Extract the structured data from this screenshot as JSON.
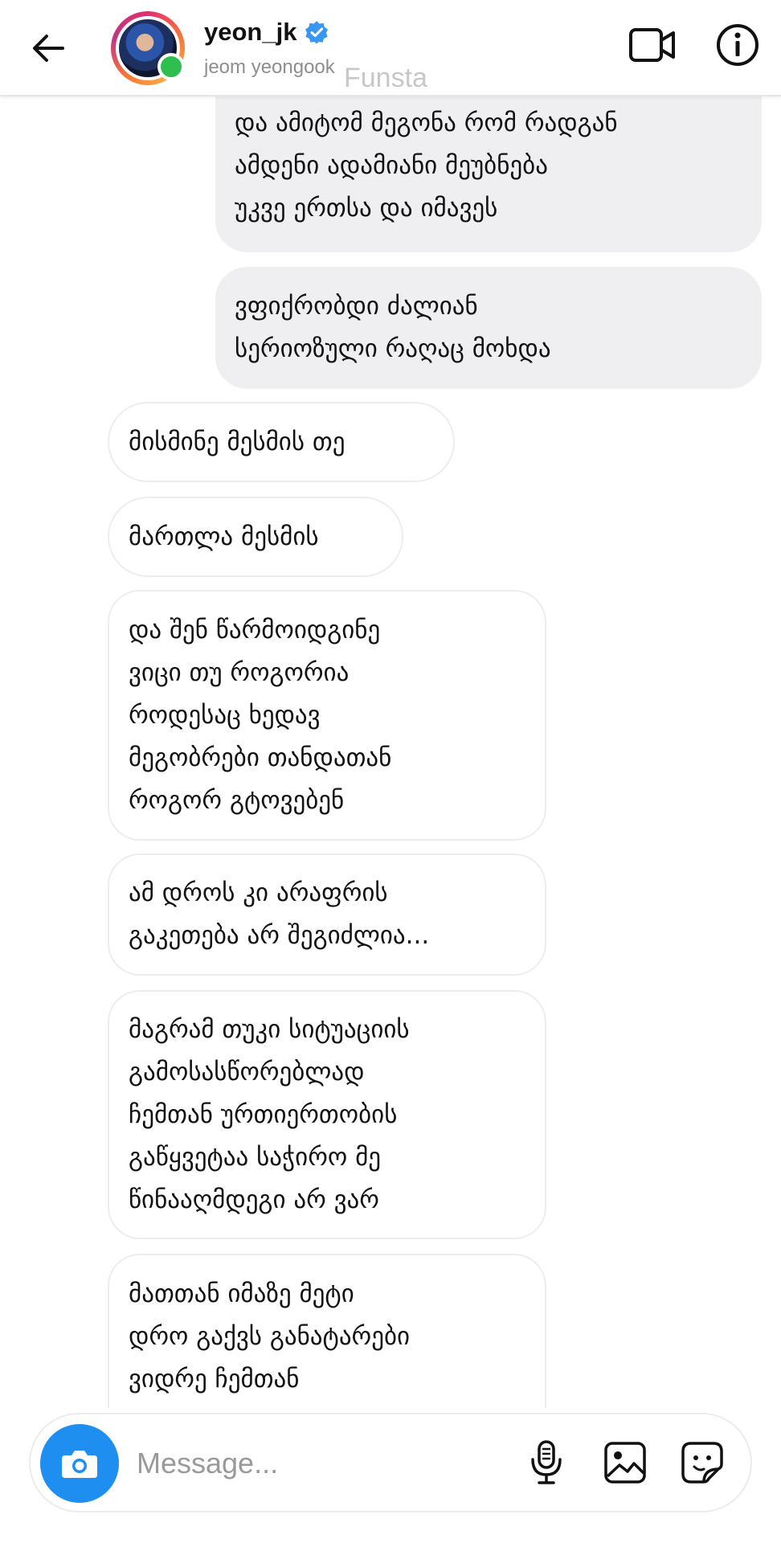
{
  "header": {
    "username": "yeon_jk",
    "subname": "jeom yeongook",
    "watermark": "Funsta"
  },
  "icons": {
    "back": "arrow-left-icon",
    "verified": "verified-badge-icon",
    "video": "video-call-icon",
    "info": "info-icon",
    "camera": "camera-icon",
    "mic": "microphone-icon",
    "gallery": "gallery-icon",
    "sticker": "sticker-icon"
  },
  "colors": {
    "accent": "#1f8ef1",
    "verified": "#3897f0",
    "online": "#2fbf4f",
    "sent_bubble": "#efeff1"
  },
  "messages": [
    {
      "direction": "sent",
      "text": "და ამიტომ მეგონა რომ რადგან\nამდენი ადამიანი მეუბნება\nუკვე ერთსა და იმავეს"
    },
    {
      "direction": "sent",
      "text": "ვფიქრობდი ძალიან\nსერიოზული რაღაც მოხდა"
    },
    {
      "direction": "received",
      "text": "მისმინე მესმის თე"
    },
    {
      "direction": "received",
      "text": "მართლა მესმის"
    },
    {
      "direction": "received",
      "text": "და შენ წარმოიდგინე\nვიცი თუ როგორია\nროდესაც ხედავ\nმეგობრები თანდათან\nროგორ გტოვებენ"
    },
    {
      "direction": "received",
      "text": "ამ დროს კი არაფრის\nგაკეთება არ შეგიძლია..."
    },
    {
      "direction": "received",
      "text": "მაგრამ თუკი სიტუაციის\nგამოსასწორებლად\nჩემთან ურთიერთობის\nგაწყვეტაა საჭირო მე\nწინააღმდეგი არ ვარ"
    },
    {
      "direction": "received",
      "text": "მათთან იმაზე მეტი\nდრო გაქვს განატარები\nვიდრე ჩემთან"
    }
  ],
  "composer": {
    "placeholder": "Message..."
  }
}
